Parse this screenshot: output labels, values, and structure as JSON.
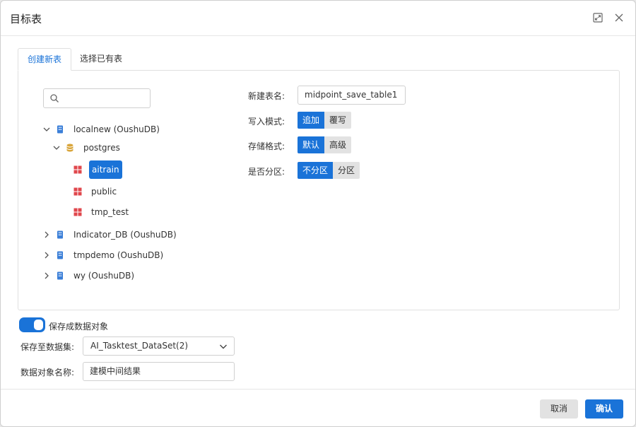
{
  "dialog": {
    "title": "目标表"
  },
  "tabs": [
    {
      "label": "创建新表",
      "active": true
    },
    {
      "label": "选择已有表",
      "active": false
    }
  ],
  "search": {
    "placeholder": "",
    "value": ""
  },
  "tree": {
    "nodes": [
      {
        "label": "localnew (OushuDB)",
        "type": "database",
        "expanded": true
      },
      {
        "label": "postgres",
        "type": "schema-group",
        "expanded": true
      },
      {
        "label": "aitrain",
        "type": "schema",
        "selected": true
      },
      {
        "label": "public",
        "type": "schema"
      },
      {
        "label": "tmp_test",
        "type": "schema"
      },
      {
        "label": "Indicator_DB (OushuDB)",
        "type": "database",
        "expanded": false
      },
      {
        "label": "tmpdemo (OushuDB)",
        "type": "database",
        "expanded": false
      },
      {
        "label": "wy (OushuDB)",
        "type": "database",
        "expanded": false
      }
    ]
  },
  "form": {
    "table_name": {
      "label": "新建表名:",
      "value": "midpoint_save_table1"
    },
    "write_mode": {
      "label": "写入模式:",
      "options": [
        "追加",
        "覆写"
      ],
      "selected": "追加"
    },
    "storage_format": {
      "label": "存储格式:",
      "options": [
        "默认",
        "高级"
      ],
      "selected": "默认"
    },
    "partition": {
      "label": "是否分区:",
      "options": [
        "不分区",
        "分区"
      ],
      "selected": "不分区"
    }
  },
  "save_object": {
    "toggle_label": "保存成数据对象",
    "toggle_on": true,
    "dataset_label": "保存至数据集:",
    "dataset_value": "AI_Tasktest_DataSet(2)",
    "name_label": "数据对象名称:",
    "name_value": "建模中间结果"
  },
  "footer": {
    "cancel_label": "取消",
    "ok_label": "确认"
  },
  "colors": {
    "accent": "#1a73d8",
    "db_icon": "#3b7fd8",
    "schema_group_icon": "#d9a53a",
    "schema_icon": "#e0474c"
  },
  "icons": [
    "maximize-icon",
    "close-icon",
    "search-icon",
    "chevron-down-icon",
    "chevron-right-icon",
    "database-icon",
    "stack-icon",
    "table-grid-icon"
  ]
}
